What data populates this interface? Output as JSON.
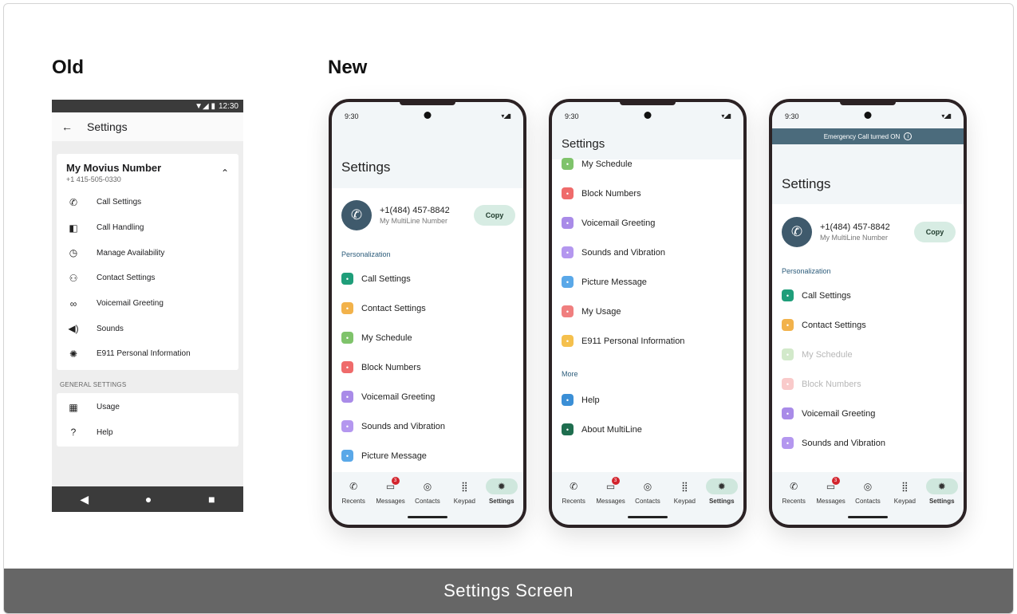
{
  "headings": {
    "old": "Old",
    "new": "New"
  },
  "caption": "Settings Screen",
  "colors": {
    "accent_green": "#cfe7dd",
    "banner": "#4b6b7c",
    "badge_red": "#d3242d",
    "caption_bg": "#666666"
  },
  "old": {
    "status_time": "12:30",
    "title": "Settings",
    "card_title": "My Movius Number",
    "card_sub": "+1 415-505-0330",
    "items": [
      {
        "icon": "call-settings-icon",
        "label": "Call Settings"
      },
      {
        "icon": "call-handling-icon",
        "label": "Call Handling"
      },
      {
        "icon": "availability-icon",
        "label": "Manage Availability"
      },
      {
        "icon": "contacts-icon",
        "label": "Contact Settings"
      },
      {
        "icon": "voicemail-icon",
        "label": "Voicemail Greeting"
      },
      {
        "icon": "sounds-icon",
        "label": "Sounds"
      },
      {
        "icon": "alert-icon",
        "label": "E911 Personal Information"
      }
    ],
    "general_label": "GENERAL SETTINGS",
    "general_items": [
      {
        "icon": "usage-icon",
        "label": "Usage"
      },
      {
        "icon": "help-icon",
        "label": "Help"
      }
    ]
  },
  "tabs": [
    {
      "icon": "phone-icon",
      "label": "Recents"
    },
    {
      "icon": "message-icon",
      "label": "Messages",
      "badge": "3"
    },
    {
      "icon": "contacts-icon",
      "label": "Contacts"
    },
    {
      "icon": "keypad-icon",
      "label": "Keypad"
    },
    {
      "icon": "gear-icon",
      "label": "Settings"
    }
  ],
  "phone1": {
    "time": "9:30",
    "title": "Settings",
    "number": "+1(484) 457-8842",
    "number_sub": "My MultiLine Number",
    "copy": "Copy",
    "section": "Personalization",
    "items": [
      {
        "label": "Call Settings",
        "color": "#1f9e7a"
      },
      {
        "label": "Contact Settings",
        "color": "#f2b24b"
      },
      {
        "label": "My Schedule",
        "color": "#7fc36b"
      },
      {
        "label": "Block Numbers",
        "color": "#ef6b6b"
      },
      {
        "label": "Voicemail Greeting",
        "color": "#a98be8"
      },
      {
        "label": "Sounds and Vibration",
        "color": "#b497ef"
      },
      {
        "label": "Picture Message",
        "color": "#5aa8e8"
      }
    ]
  },
  "phone2": {
    "time": "9:30",
    "title": "Settings",
    "items": [
      {
        "label": "My Schedule",
        "color": "#7fc36b"
      },
      {
        "label": "Block Numbers",
        "color": "#ef6b6b"
      },
      {
        "label": "Voicemail Greeting",
        "color": "#a98be8"
      },
      {
        "label": "Sounds and Vibration",
        "color": "#b497ef"
      },
      {
        "label": "Picture Message",
        "color": "#5aa8e8"
      },
      {
        "label": "My Usage",
        "color": "#f07f7f"
      },
      {
        "label": "E911 Personal Information",
        "color": "#f5c04d"
      }
    ],
    "section_more": "More",
    "more_items": [
      {
        "label": "Help",
        "color": "#3b8fd6"
      },
      {
        "label": "About MultiLine",
        "color": "#1f6e4f"
      }
    ]
  },
  "phone3": {
    "time": "9:30",
    "banner": "Emergency Call turned ON",
    "title": "Settings",
    "number": "+1(484) 457-8842",
    "number_sub": "My MultiLine Number",
    "copy": "Copy",
    "section": "Personalization",
    "items": [
      {
        "label": "Call Settings",
        "color": "#1f9e7a"
      },
      {
        "label": "Contact Settings",
        "color": "#f2b24b"
      },
      {
        "label": "My Schedule",
        "color": "#7fc36b",
        "disabled": true
      },
      {
        "label": "Block Numbers",
        "color": "#ef6b6b",
        "disabled": true
      },
      {
        "label": "Voicemail Greeting",
        "color": "#a98be8"
      },
      {
        "label": "Sounds and Vibration",
        "color": "#b497ef"
      }
    ]
  }
}
